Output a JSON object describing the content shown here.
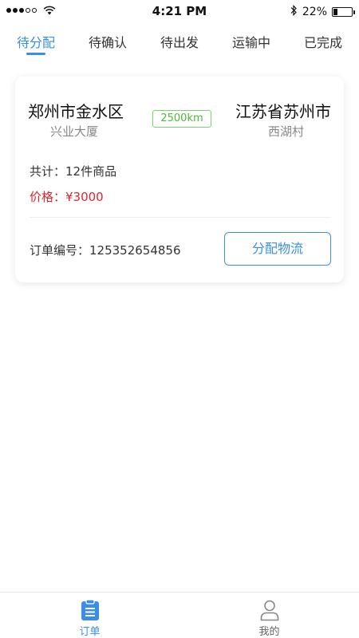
{
  "status_bar": {
    "time": "4:21 PM",
    "battery": "22%",
    "battery_level": 0.22
  },
  "tabs": [
    {
      "label": "待分配",
      "active": true
    },
    {
      "label": "待确认",
      "active": false
    },
    {
      "label": "待出发",
      "active": false
    },
    {
      "label": "运输中",
      "active": false
    },
    {
      "label": "已完成",
      "active": false
    }
  ],
  "order": {
    "from_city": "郑州市金水区",
    "from_detail": "兴业大厦",
    "to_city": "江苏省苏州市",
    "to_detail": "西湖村",
    "distance": "2500km",
    "count": "共计：12件商品",
    "price": "价格：¥3000",
    "order_number": "订单编号：125352654856",
    "assign_button": "分配物流"
  },
  "bottom_nav": [
    {
      "label": "订单",
      "icon": "clipboard-icon",
      "active": true
    },
    {
      "label": "我的",
      "icon": "user-icon",
      "active": false
    }
  ],
  "colors": {
    "accent": "#3a8ee6",
    "price": "#e0252a",
    "distance": "#4cb93a"
  }
}
